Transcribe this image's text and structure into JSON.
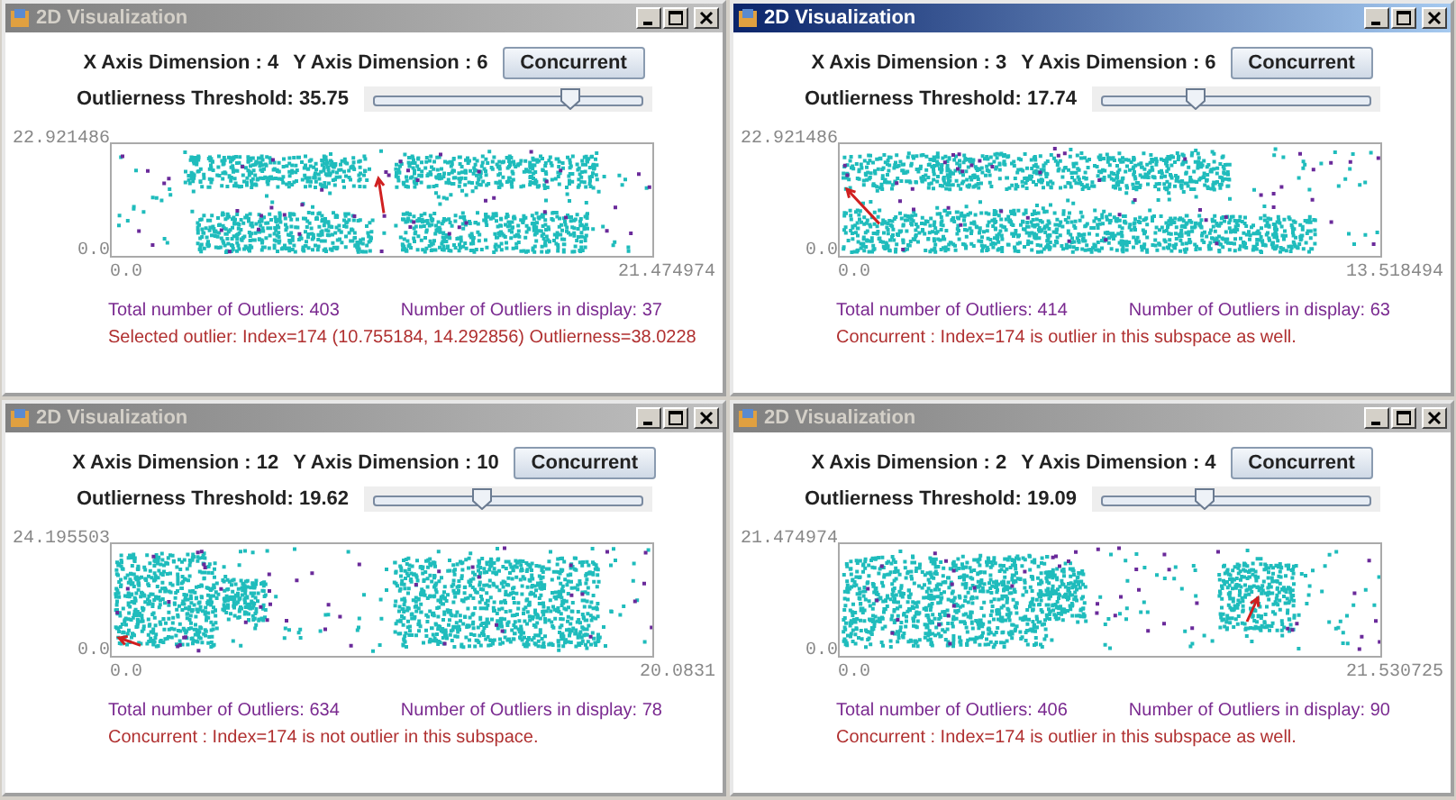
{
  "windows": [
    {
      "title": "2D Visualization",
      "active": false,
      "x_dimension": "X Axis Dimension : 4",
      "y_dimension": "Y Axis Dimension : 6",
      "button": "Concurrent",
      "threshold_label": "Outlierness Threshold: 35.75",
      "threshold_slider": {
        "level": 0.73
      },
      "y_max": "22.921486",
      "y_min": "0.0",
      "x_min": "0.0",
      "x_max": "21.474974",
      "total_outliers": "Total number of Outliers: 403",
      "outliers_in_display": "Number of Outliers in display: 37",
      "message": "Selected outlier: Index=174 (10.755184, 14.292856) Outlierness=38.0228"
    },
    {
      "title": "2D Visualization",
      "active": true,
      "x_dimension": "X Axis Dimension : 3",
      "y_dimension": "Y Axis Dimension : 6",
      "button": "Concurrent",
      "threshold_label": "Outlierness Threshold: 17.74",
      "threshold_slider": {
        "level": 0.35
      },
      "y_max": "22.921486",
      "y_min": "0.0",
      "x_min": "0.0",
      "x_max": "13.518494",
      "total_outliers": "Total number of Outliers: 414",
      "outliers_in_display": "Number of Outliers in display: 63",
      "message": "Concurrent : Index=174 is outlier in this subspace as well."
    },
    {
      "title": "2D Visualization",
      "active": false,
      "x_dimension": "X Axis Dimension : 12",
      "y_dimension": "Y Axis Dimension : 10",
      "button": "Concurrent",
      "threshold_label": "Outlierness Threshold: 19.62",
      "threshold_slider": {
        "level": 0.4
      },
      "y_max": "24.195503",
      "y_min": "0.0",
      "x_min": "0.0",
      "x_max": "20.0831",
      "total_outliers": "Total number of Outliers: 634",
      "outliers_in_display": "Number of Outliers in display: 78",
      "message": "Concurrent : Index=174 is not outlier in this subspace."
    },
    {
      "title": "2D Visualization",
      "active": false,
      "x_dimension": "X Axis Dimension : 2",
      "y_dimension": "Y Axis Dimension : 4",
      "button": "Concurrent",
      "threshold_label": "Outlierness Threshold: 19.09",
      "threshold_slider": {
        "level": 0.38
      },
      "y_max": "21.474974",
      "y_min": "0.0",
      "x_min": "0.0",
      "x_max": "21.530725",
      "total_outliers": "Total number of Outliers: 406",
      "outliers_in_display": "Number of Outliers in display: 90",
      "message": "Concurrent : Index=174 is outlier in this subspace as well."
    }
  ]
}
